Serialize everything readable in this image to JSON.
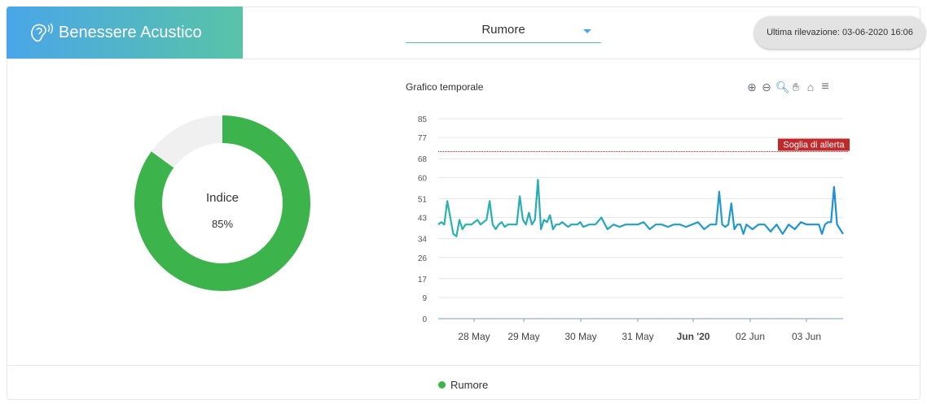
{
  "header": {
    "title": "Benessere Acustico",
    "metric_select": "Rumore",
    "last_reading": "Ultima rilevazione: 03-06-2020 16:06"
  },
  "gauge": {
    "label": "Indice",
    "value_text": "85%",
    "percent": 85,
    "color": "#3cb44b",
    "track_color": "#f0f0f0"
  },
  "chart": {
    "title": "Grafico temporale",
    "toolbar": [
      "zoom-in-icon",
      "zoom-out-icon",
      "search-zoom-icon",
      "pan-hand-icon",
      "home-icon",
      "menu-icon"
    ]
  },
  "legend": {
    "label": "Rumore",
    "color": "#3cb44b"
  },
  "chart_data": {
    "type": "line",
    "title": "Grafico temporale",
    "y_ticks": [
      0,
      9,
      17,
      26,
      34,
      43,
      51,
      60,
      68,
      77,
      85
    ],
    "ylim": [
      0,
      85
    ],
    "x_ticks": [
      "28 May",
      "29 May",
      "30 May",
      "31 May",
      "Jun '20",
      "02 Jun",
      "03 Jun"
    ],
    "bold_x_tick": "Jun '20",
    "threshold": {
      "value": 71,
      "label": "Soglia di allerta",
      "color": "#c0292b"
    },
    "series": [
      {
        "name": "Rumore",
        "color_start": "#2bb5a8",
        "color_end": "#1e8fd8",
        "x_days": [
          0,
          0.05,
          0.1,
          0.15,
          0.2,
          0.25,
          0.3,
          0.35,
          0.4,
          0.45,
          0.5,
          0.55,
          0.6,
          0.65,
          0.7,
          0.75,
          0.8,
          0.85,
          0.9,
          0.95,
          1.0,
          1.05,
          1.1,
          1.15,
          1.2,
          1.25,
          1.3,
          1.35,
          1.4,
          1.45,
          1.5,
          1.55,
          1.6,
          1.65,
          1.7,
          1.75,
          1.8,
          1.85,
          1.9,
          1.95,
          2.0,
          2.05,
          2.1,
          2.15,
          2.2,
          2.25,
          2.3,
          2.35,
          2.4,
          2.5,
          2.6,
          2.7,
          2.8,
          2.9,
          3.0,
          3.1,
          3.2,
          3.3,
          3.4,
          3.5,
          3.6,
          3.7,
          3.8,
          3.9,
          4.0,
          4.1,
          4.2,
          4.3,
          4.4,
          4.5,
          4.6,
          4.65,
          4.7,
          4.75,
          4.8,
          4.85,
          4.9,
          4.95,
          5.0,
          5.05,
          5.1,
          5.2,
          5.3,
          5.4,
          5.5,
          5.6,
          5.7,
          5.8,
          5.9,
          6.0,
          6.1,
          6.2,
          6.3,
          6.35,
          6.4,
          6.45,
          6.5,
          6.55,
          6.6,
          6.65,
          6.7
        ],
        "values": [
          40,
          41,
          40,
          50,
          43,
          36,
          35,
          42,
          38,
          40,
          40,
          40,
          41,
          42,
          40,
          41,
          42,
          50,
          40,
          38,
          40,
          41,
          39,
          40,
          40,
          40,
          40,
          52,
          42,
          40,
          45,
          40,
          42,
          59,
          38,
          42,
          41,
          44,
          38,
          40,
          40,
          41,
          40,
          39,
          40,
          40,
          40,
          41,
          39,
          40,
          40,
          43,
          38,
          40,
          39,
          40,
          40,
          40,
          41,
          38,
          40,
          40,
          39,
          40,
          40,
          39,
          40,
          41,
          38,
          40,
          40,
          54,
          40,
          39,
          40,
          49,
          38,
          40,
          40,
          36,
          40,
          38,
          40,
          40,
          37,
          40,
          36,
          40,
          38,
          41,
          40,
          40,
          40,
          36,
          40,
          41,
          41,
          56,
          40,
          38,
          36
        ]
      }
    ]
  }
}
